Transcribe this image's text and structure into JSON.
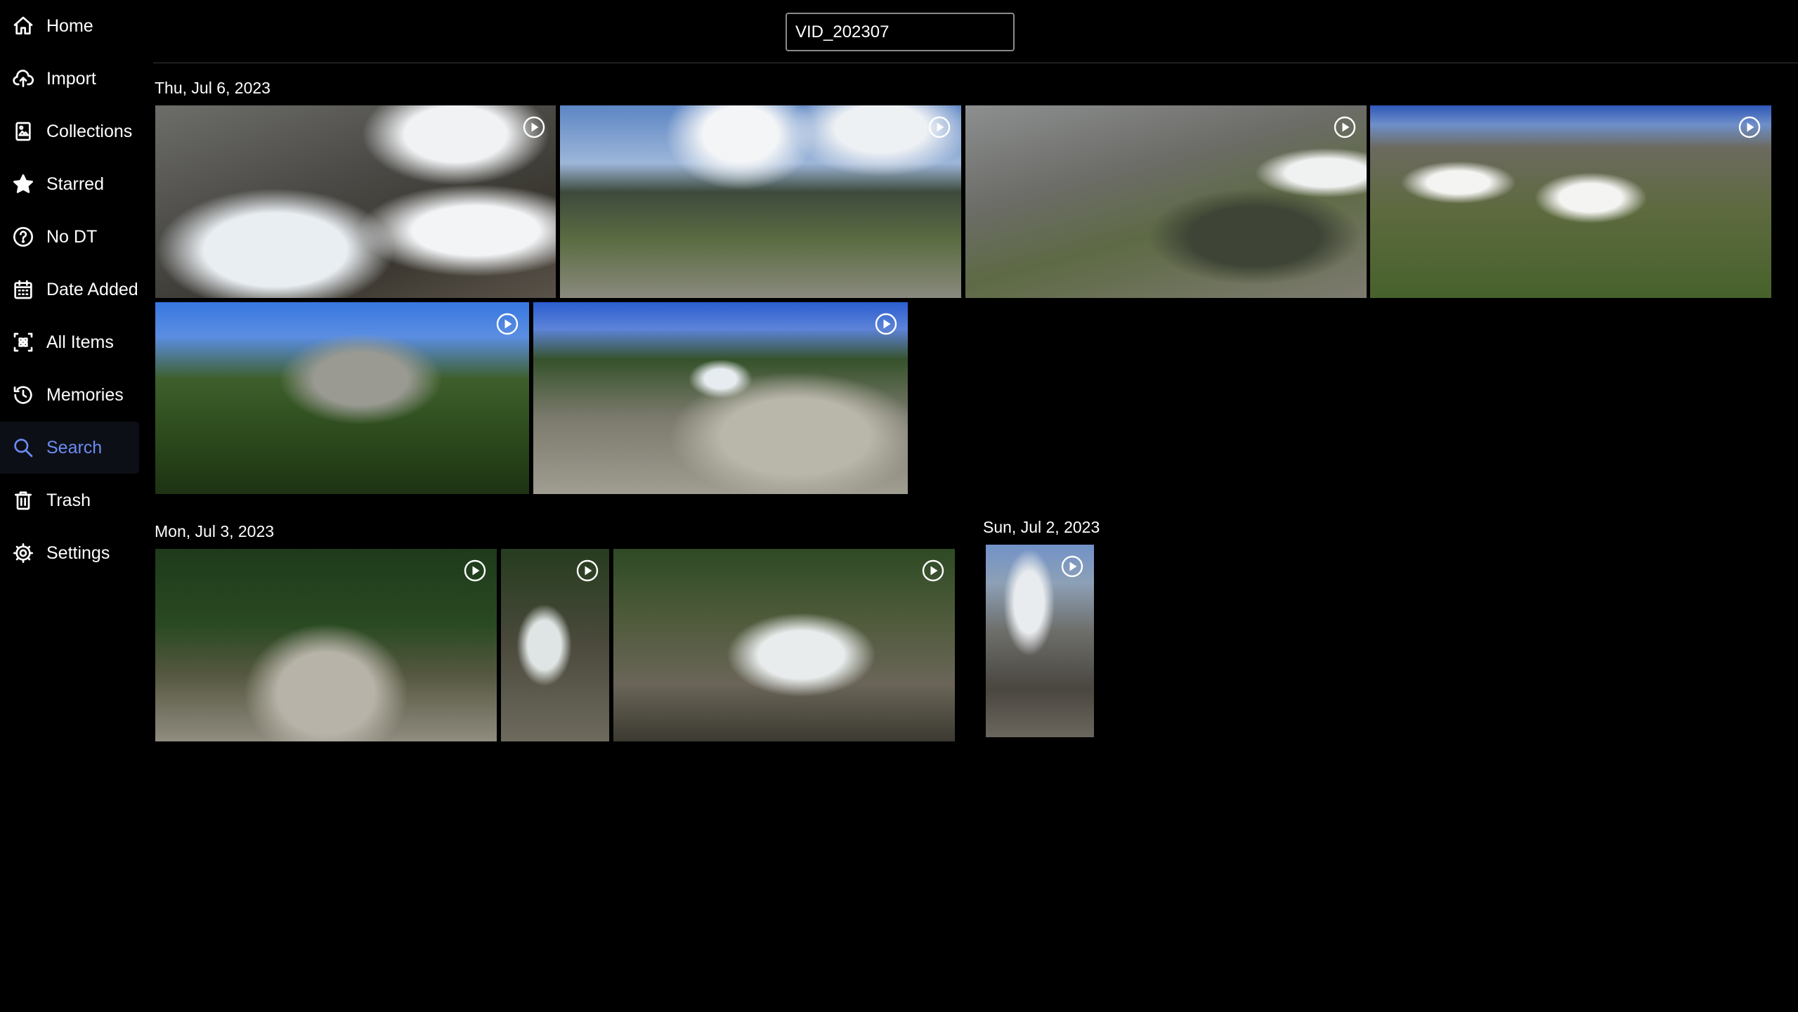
{
  "sidebar": {
    "items": [
      {
        "label": "Home",
        "icon": "home-icon"
      },
      {
        "label": "Import",
        "icon": "cloud-upload-icon"
      },
      {
        "label": "Collections",
        "icon": "collections-icon"
      },
      {
        "label": "Starred",
        "icon": "star-icon"
      },
      {
        "label": "No DT",
        "icon": "question-circle-icon"
      },
      {
        "label": "Date Added",
        "icon": "calendar-icon"
      },
      {
        "label": "All Items",
        "icon": "grid-icon"
      },
      {
        "label": "Memories",
        "icon": "history-icon"
      },
      {
        "label": "Search",
        "icon": "search-icon",
        "active": true
      },
      {
        "label": "Trash",
        "icon": "trash-icon"
      },
      {
        "label": "Settings",
        "icon": "gear-icon"
      }
    ],
    "active_color": "#6a8cf3"
  },
  "search": {
    "value": "VID_202307"
  },
  "groups": [
    {
      "date": "Thu, Jul 6, 2023",
      "item_count": 6
    },
    {
      "date": "Mon, Jul 3, 2023",
      "item_count": 3
    },
    {
      "date": "Sun, Jul 2, 2023",
      "item_count": 1
    }
  ],
  "thumbnails": [
    {
      "scene": "waterfall with snow",
      "type": "video",
      "play_icon": "play-circle-icon"
    },
    {
      "scene": "mountain valley under cloudy sky",
      "type": "video",
      "play_icon": "play-circle-icon"
    },
    {
      "scene": "alpine lake with rocky slope",
      "type": "video",
      "play_icon": "play-circle-icon"
    },
    {
      "scene": "snow patches on green hillside",
      "type": "video",
      "play_icon": "play-circle-icon"
    },
    {
      "scene": "pine trees and rocky cliff",
      "type": "video",
      "play_icon": "play-circle-icon"
    },
    {
      "scene": "twin waterfalls over granite",
      "type": "video",
      "play_icon": "play-circle-icon"
    },
    {
      "scene": "forest stream over rock",
      "type": "video",
      "play_icon": "play-circle-icon"
    },
    {
      "scene": "narrow cascade",
      "type": "video",
      "play_icon": "play-circle-icon"
    },
    {
      "scene": "wide cascade with fallen logs",
      "type": "video",
      "play_icon": "play-circle-icon"
    },
    {
      "scene": "mine ruins below snowy peaks",
      "type": "video",
      "play_icon": "play-circle-icon"
    }
  ]
}
